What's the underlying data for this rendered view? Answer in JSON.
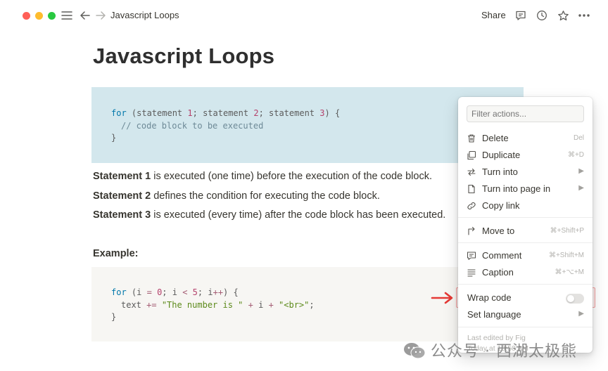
{
  "topbar": {
    "title": "Javascript Loops",
    "share_label": "Share",
    "icons": [
      "menu-icon",
      "back-arrow-icon",
      "forward-arrow-icon",
      "comment-icon",
      "clock-icon",
      "star-icon",
      "more-icon"
    ]
  },
  "page": {
    "title": "Javascript Loops",
    "code1": {
      "line1": {
        "kw": "for",
        "p1": " (statement ",
        "n1": "1",
        "p2": "; statement ",
        "n2": "2",
        "p3": "; statement ",
        "n3": "3",
        "p4": ") {"
      },
      "line2": "// code block to be executed",
      "line3": "}"
    },
    "para1": {
      "bold": "Statement 1",
      "rest": " is executed (one time) before the execution of the code block."
    },
    "para2": {
      "bold": "Statement 2",
      "rest": " defines the condition for executing the code block."
    },
    "para3": {
      "bold": "Statement 3",
      "rest": " is executed (every time) after the code block has been executed."
    },
    "example_heading": "Example:",
    "code2": {
      "line1": {
        "kw": "for",
        "p1": " (i ",
        "op1": "=",
        "p2": " ",
        "n1": "0",
        "p3": "; i ",
        "op2": "<",
        "p4": " ",
        "n2": "5",
        "p5": "; i",
        "op3": "++",
        "p6": ") {"
      },
      "line2": {
        "p1": "text ",
        "op1": "+=",
        "p2": " ",
        "s1": "\"The number is \"",
        "p3": " ",
        "op2": "+",
        "p4": " i ",
        "op3": "+",
        "p5": " ",
        "s2": "\"<br>\"",
        "p6": ";"
      },
      "line3": "}"
    }
  },
  "menu": {
    "filter_placeholder": "Filter actions...",
    "items": {
      "delete": {
        "label": "Delete",
        "shortcut": "Del",
        "icon": "trash-icon"
      },
      "duplicate": {
        "label": "Duplicate",
        "shortcut": "⌘+D",
        "icon": "duplicate-icon"
      },
      "turn_into": {
        "label": "Turn into",
        "icon": "turn-into-icon"
      },
      "turn_into_page": {
        "label": "Turn into page in",
        "icon": "page-icon"
      },
      "copy_link": {
        "label": "Copy link",
        "icon": "link-icon"
      },
      "move_to": {
        "label": "Move to",
        "shortcut": "⌘+Shift+P",
        "icon": "move-to-icon"
      },
      "comment": {
        "label": "Comment",
        "shortcut": "⌘+Shift+M",
        "icon": "comment-icon"
      },
      "caption": {
        "label": "Caption",
        "shortcut": "⌘+⌥+M",
        "icon": "caption-icon"
      },
      "wrap_code": {
        "label": "Wrap code",
        "enabled": false
      },
      "set_language": {
        "label": "Set language"
      }
    },
    "footer_line1": "Last edited by Fig",
    "footer_line2": "Today at 10:50 AM"
  },
  "watermark": {
    "text": "公众号 · 西湖太极熊"
  },
  "colors": {
    "code1_bg": "#d3e7ed",
    "code2_bg": "#f7f6f3",
    "highlight_border": "#f3a1a1",
    "arrow": "#e53935"
  }
}
